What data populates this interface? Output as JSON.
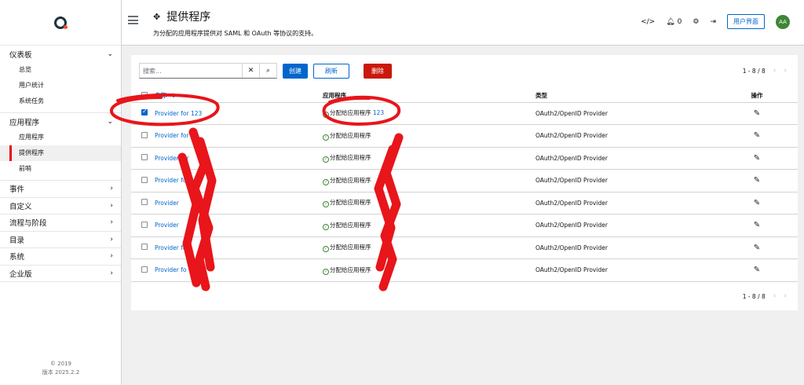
{
  "sidebar": {
    "footer_line1": "© 2019",
    "footer_line2": "版本 2025.2.2",
    "groups": [
      {
        "label": "仪表板",
        "expanded": true,
        "items": [
          "总览",
          "用户统计",
          "系统任务"
        ]
      },
      {
        "label": "应用程序",
        "expanded": true,
        "items": [
          "应用程序",
          "提供程序",
          "前哨"
        ]
      }
    ],
    "collapsed": [
      "事件",
      "自定义",
      "流程与阶段",
      "目录",
      "系统",
      "企业版"
    ]
  },
  "header": {
    "title": "提供程序",
    "description": "为分配的应用程序提供对 SAML 和 OAuth 等协议的支持。",
    "notification_count": "0",
    "user_interface_label": "用户界面",
    "avatar_initials": "AA"
  },
  "toolbar": {
    "search_placeholder": "搜索...",
    "clear_icon": "✕",
    "search_icon": "⌕",
    "create_label": "创建",
    "refresh_label": "刷新",
    "delete_label": "删除"
  },
  "pagination": {
    "top": "1 - 8 / 8",
    "bottom": "1 - 8 / 8"
  },
  "table": {
    "headers": {
      "name": "名称",
      "app": "应用程序",
      "type": "类型",
      "actions": "操作"
    },
    "rows": [
      {
        "name": "Provider for 123",
        "app_prefix": "分配给应用程序",
        "app_name": "123",
        "type": "OAuth2/OpenID Provider",
        "checked": true
      },
      {
        "name": "Provider for",
        "app_prefix": "分配给应用程序",
        "app_name": "",
        "type": "OAuth2/OpenID Provider",
        "checked": false
      },
      {
        "name": "Provider for",
        "app_prefix": "分配给应用程序",
        "app_name": "",
        "type": "OAuth2/OpenID Provider",
        "checked": false
      },
      {
        "name": "Provider for",
        "app_prefix": "分配给应用程序",
        "app_name": "",
        "type": "OAuth2/OpenID Provider",
        "checked": false
      },
      {
        "name": "Provider",
        "app_prefix": "分配给应用程序",
        "app_name": "",
        "type": "OAuth2/OpenID Provider",
        "checked": false
      },
      {
        "name": "Provider",
        "app_prefix": "分配给应用程序",
        "app_name": "",
        "type": "OAuth2/OpenID Provider",
        "checked": false
      },
      {
        "name": "Provider fo",
        "app_prefix": "分配给应用程序",
        "app_name": "",
        "type": "OAuth2/OpenID Provider",
        "checked": false
      },
      {
        "name": "Provider fo",
        "app_prefix": "分配给应用程序",
        "app_name": "",
        "type": "OAuth2/OpenID Provider",
        "checked": false
      }
    ]
  },
  "colors": {
    "primary": "#0066cc",
    "danger": "#c9190b",
    "annotation": "#e8151b",
    "avatar": "#3e8635"
  }
}
